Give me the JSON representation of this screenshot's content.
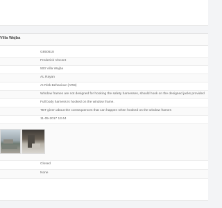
{
  "header": {
    "title": "Villa Wajba"
  },
  "details": {
    "rows": [
      "G850618",
      "Frederick Vincent",
      "500 Villa Wajba",
      "AL Rayan",
      "At Risk Behaviour (ARB)",
      "Window frames are not designed for hooking the safety harnesses, should hook on the designed jacks provided",
      "Full body harness is hooked on the window frame.",
      "TBT given about the consequences that can happen when hooked on the window frames",
      "11-05-2017 13:44"
    ],
    "photos": [
      "site-photo-1",
      "site-photo-2"
    ],
    "status": "Closed",
    "extra": "None"
  }
}
